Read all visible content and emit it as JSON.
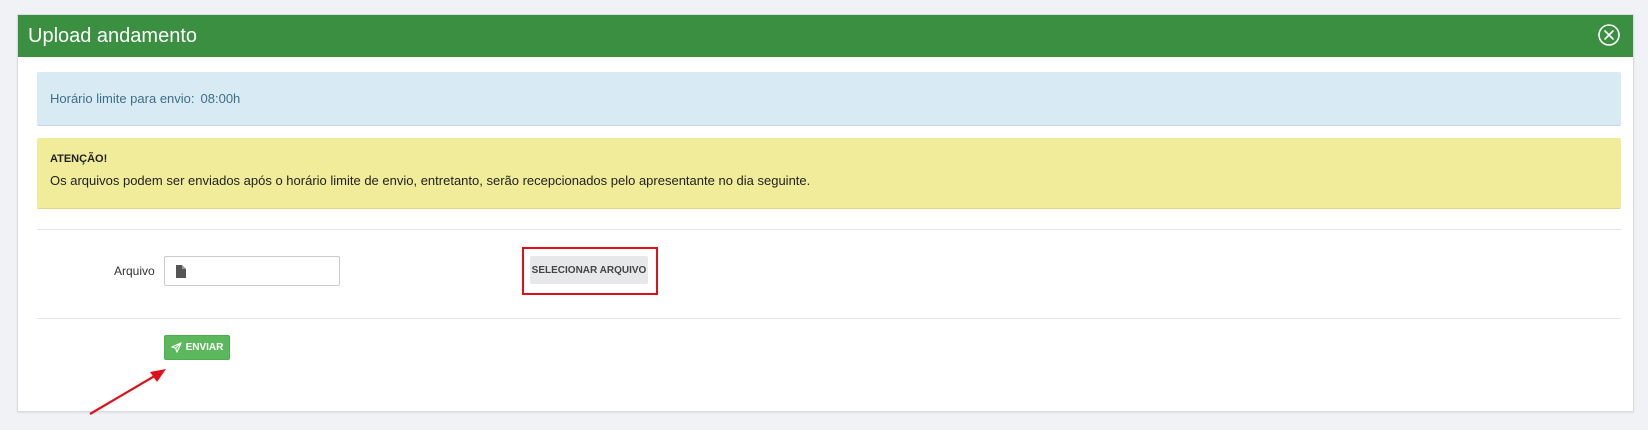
{
  "panel": {
    "title": "Upload andamento",
    "close_icon": "circle-x-icon"
  },
  "info": {
    "label": "Horário limite para envio:",
    "value": "08:00h"
  },
  "warning": {
    "title": "ATENÇÃO!",
    "text": "Os arquivos podem ser enviados após o horário limite de envio, entretanto, serão recepcionados pelo apresentante no dia seguinte."
  },
  "form": {
    "file_label": "Arquivo",
    "file_value": "",
    "file_icon": "file-icon",
    "select_button": "SELECIONAR ARQUIVO",
    "send_button": "ENVIAR",
    "send_icon": "paper-plane-icon"
  },
  "colors": {
    "header": "#3a9040",
    "info_bg": "#d8ebf5",
    "warning_bg": "#f1ec99",
    "send_button": "#5cb85c",
    "highlight": "#e0101a"
  }
}
